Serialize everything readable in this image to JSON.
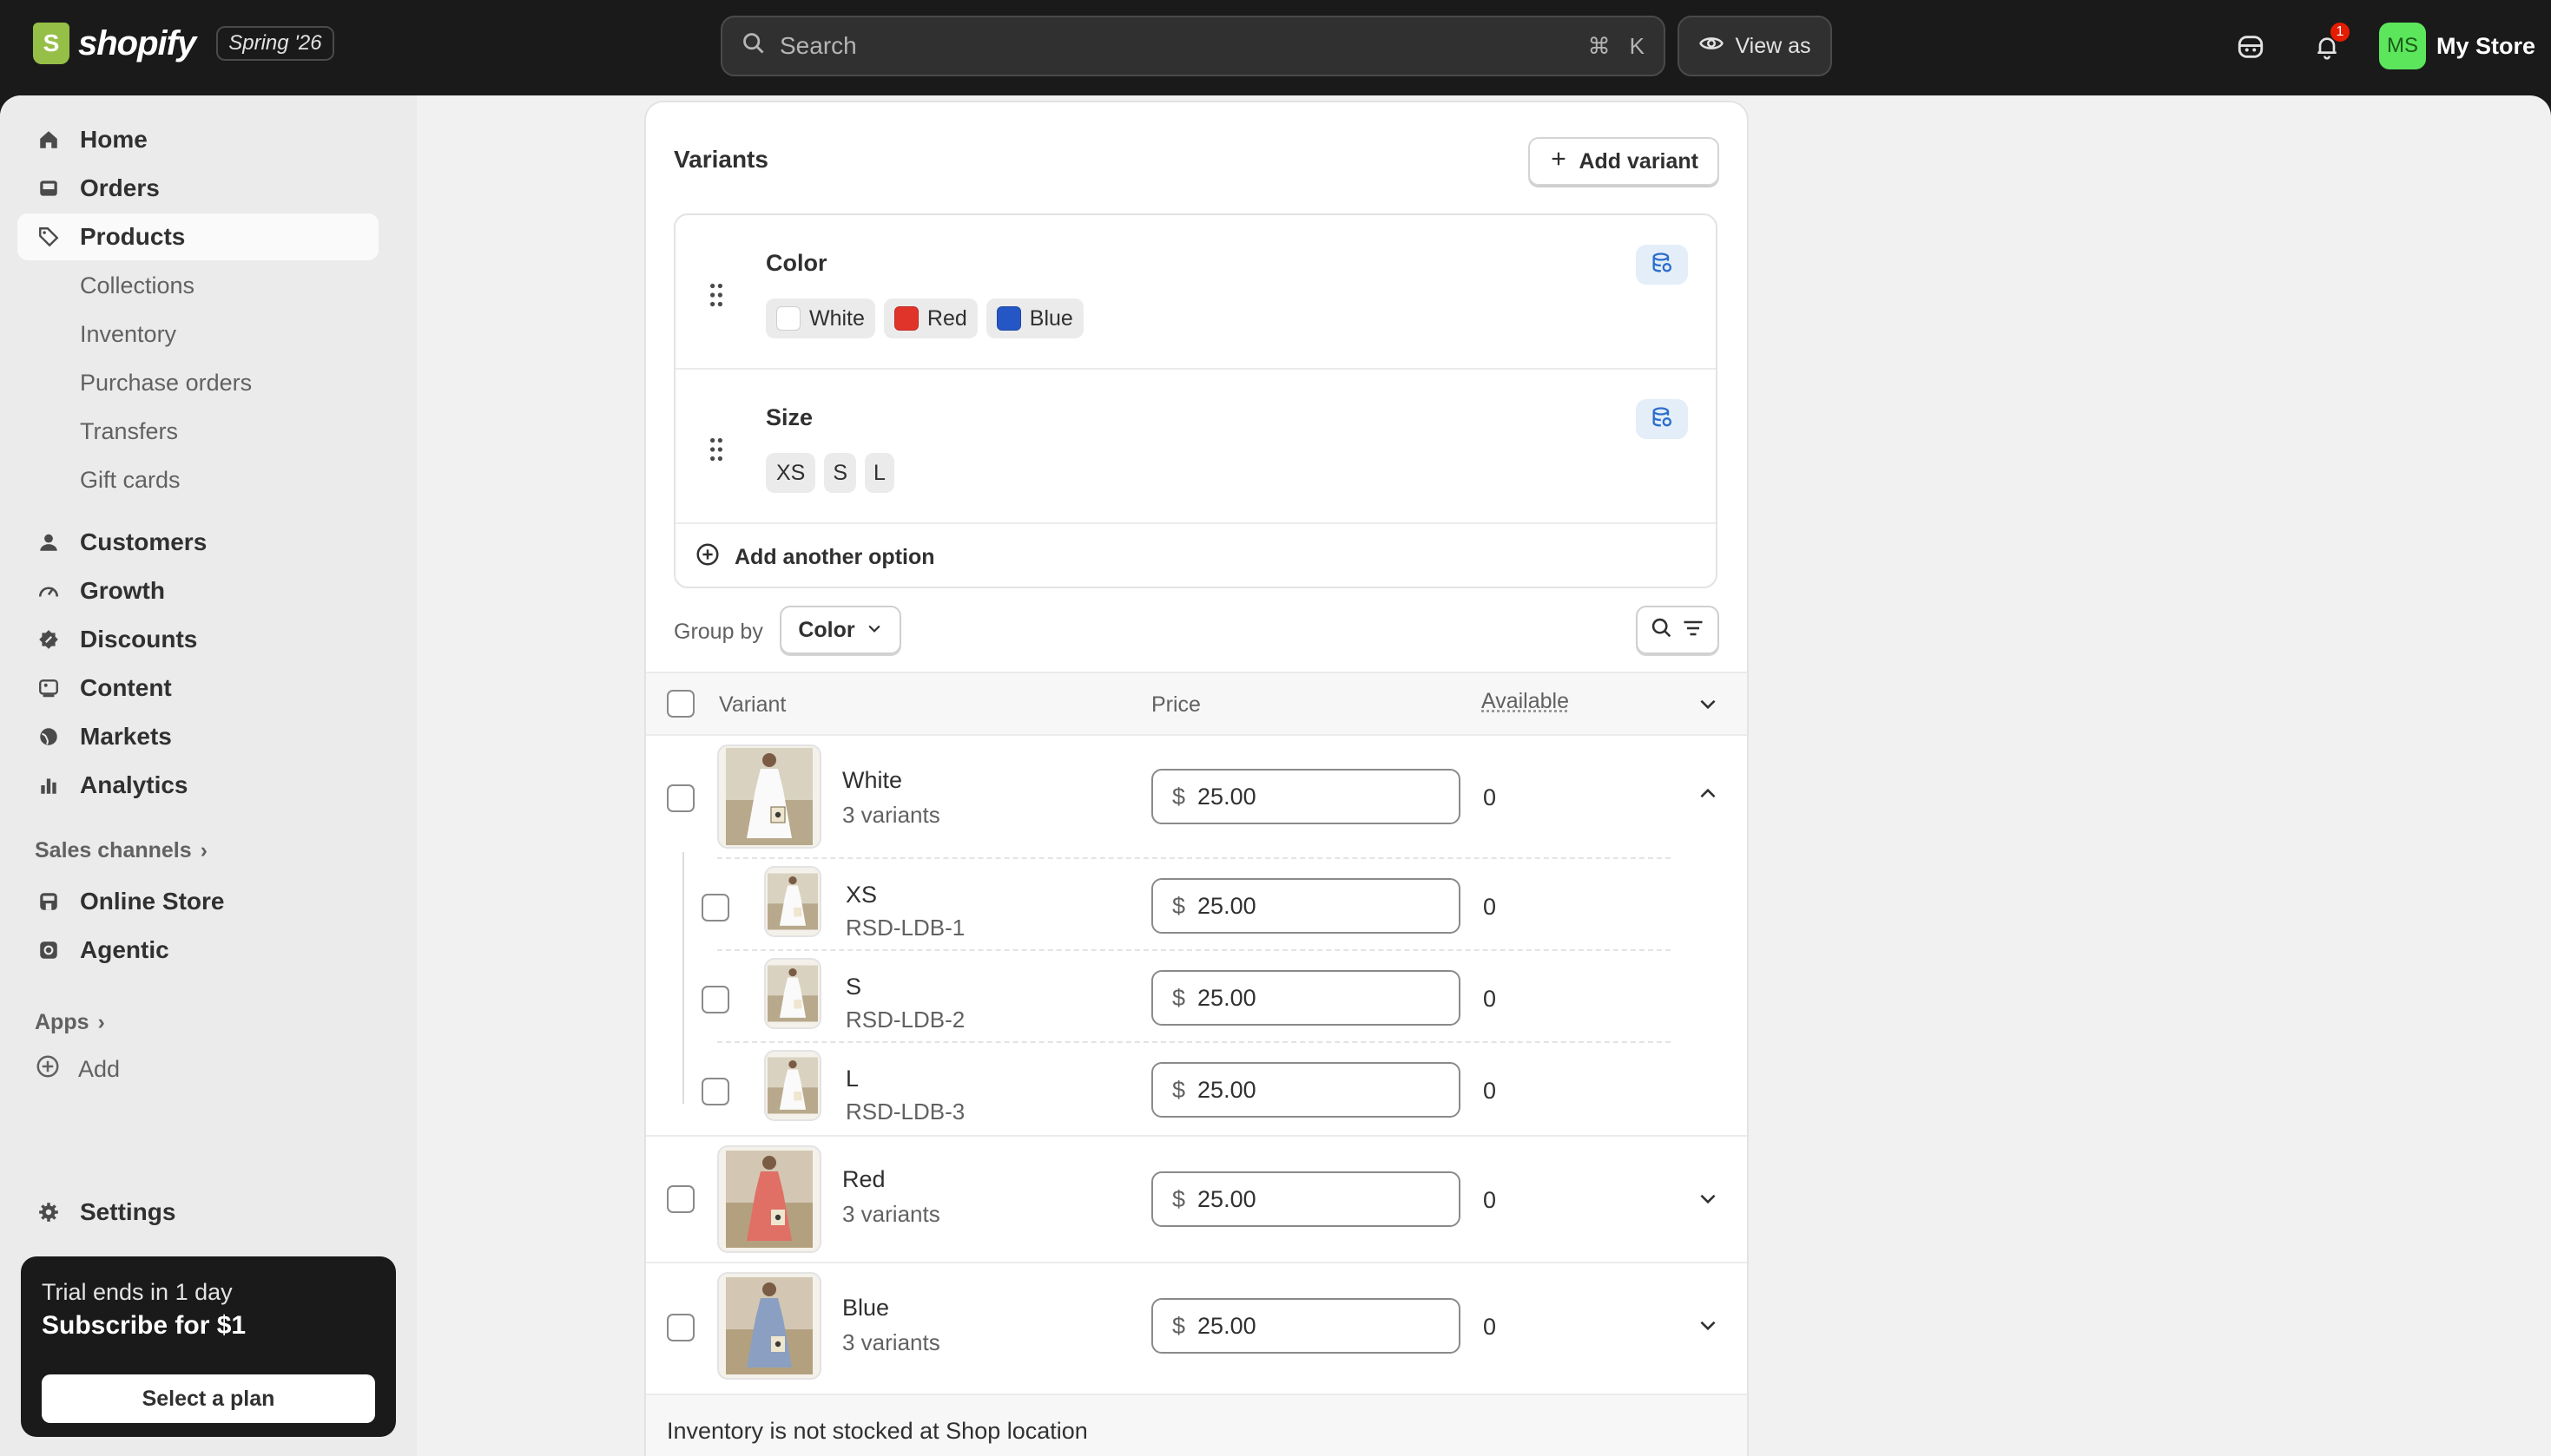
{
  "topbar": {
    "brand": "shopify",
    "season_badge": "Spring '26",
    "search_placeholder": "Search",
    "shortcut_cmd": "⌘",
    "shortcut_key": "K",
    "view_as_label": "View as",
    "notification_count": "1",
    "avatar_initials": "MS",
    "store_name": "My Store"
  },
  "sidebar": {
    "items": [
      {
        "label": "Home",
        "icon": "home-icon"
      },
      {
        "label": "Orders",
        "icon": "inbox-icon"
      },
      {
        "label": "Products",
        "icon": "tag-icon"
      },
      {
        "label": "Customers",
        "icon": "person-icon"
      },
      {
        "label": "Growth",
        "icon": "gauge-icon"
      },
      {
        "label": "Discounts",
        "icon": "discount-icon"
      },
      {
        "label": "Content",
        "icon": "image-icon"
      },
      {
        "label": "Markets",
        "icon": "globe-icon"
      },
      {
        "label": "Analytics",
        "icon": "bar-chart-icon"
      }
    ],
    "product_subitems": [
      "Collections",
      "Inventory",
      "Purchase orders",
      "Transfers",
      "Gift cards"
    ],
    "sales_channels_label": "Sales channels",
    "channels": [
      "Online Store",
      "Agentic"
    ],
    "apps_label": "Apps",
    "add_label": "Add",
    "settings_label": "Settings",
    "trial": {
      "line1": "Trial ends in 1 day",
      "line2": "Subscribe for $1",
      "button": "Select a plan"
    }
  },
  "variants_card": {
    "title": "Variants",
    "add_variant_label": "Add variant",
    "options": [
      {
        "name": "Color",
        "values": [
          {
            "label": "White",
            "swatch": "#ffffff"
          },
          {
            "label": "Red",
            "swatch": "#e0342b"
          },
          {
            "label": "Blue",
            "swatch": "#2457c5"
          }
        ]
      },
      {
        "name": "Size",
        "values": [
          {
            "label": "XS"
          },
          {
            "label": "S"
          },
          {
            "label": "L"
          }
        ]
      }
    ],
    "add_option_label": "Add another option",
    "group_by_label": "Group by",
    "group_by_value": "Color",
    "columns": {
      "variant": "Variant",
      "price": "Price",
      "available": "Available"
    },
    "groups": [
      {
        "name": "White",
        "subtitle": "3 variants",
        "currency": "$",
        "price": "25.00",
        "available": "0",
        "expanded": true,
        "children": [
          {
            "name": "XS",
            "sku": "RSD-LDB-1",
            "currency": "$",
            "price": "25.00",
            "available": "0"
          },
          {
            "name": "S",
            "sku": "RSD-LDB-2",
            "currency": "$",
            "price": "25.00",
            "available": "0"
          },
          {
            "name": "L",
            "sku": "RSD-LDB-3",
            "currency": "$",
            "price": "25.00",
            "available": "0"
          }
        ]
      },
      {
        "name": "Red",
        "subtitle": "3 variants",
        "currency": "$",
        "price": "25.00",
        "available": "0",
        "expanded": false
      },
      {
        "name": "Blue",
        "subtitle": "3 variants",
        "currency": "$",
        "price": "25.00",
        "available": "0",
        "expanded": false
      }
    ],
    "footer_note": "Inventory is not stocked at Shop location"
  },
  "colors": {
    "topbar_bg": "#1a1a1a",
    "page_bg": "#f1f1f1",
    "accent_green": "#95bf47",
    "metafield_blue": "#2c6ecb",
    "notification_red": "#e51c00"
  }
}
